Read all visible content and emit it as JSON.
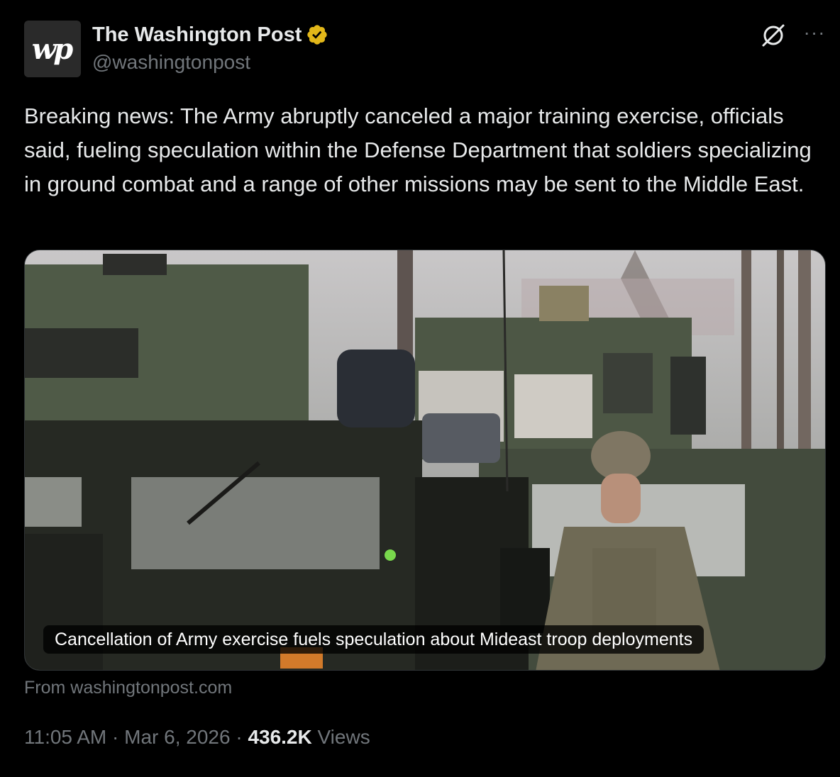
{
  "author": {
    "avatar_text": "wp",
    "display_name": "The Washington Post",
    "handle": "@washingtonpost",
    "verified_color": "#e2b719"
  },
  "actions": {
    "grok_icon": "grok-icon",
    "more_label": "···"
  },
  "tweet": {
    "text": "Breaking news: The Army abruptly canceled a major training exercise, officials said, fueling speculation within the Defense Department that soldiers specializing in ground combat and a range of other missions may be sent to the Middle East."
  },
  "card": {
    "caption": "Cancellation of Army exercise fuels speculation about Mideast troop deployments",
    "source": "From washingtonpost.com"
  },
  "meta": {
    "time": "11:05 AM",
    "separator": " · ",
    "date": "Mar 6, 2026",
    "views_count": "436.2K",
    "views_label": "Views"
  },
  "colors": {
    "background": "#000000",
    "text": "#e7e9ea",
    "secondary": "#71767b"
  }
}
